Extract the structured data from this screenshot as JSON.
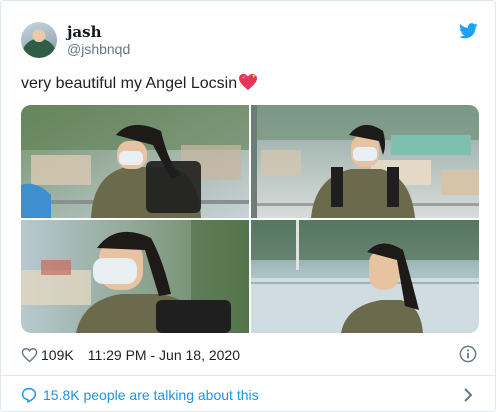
{
  "user": {
    "display_name": "jash",
    "handle": "@jshbnqd",
    "avatar_icon": "avatar-photo"
  },
  "brand_icon": "twitter-bird-icon",
  "tweet": {
    "text": "very beautiful my Angel Locsin",
    "emoji": "sparkling-heart"
  },
  "media": {
    "photos": [
      {
        "name": "photo-1"
      },
      {
        "name": "photo-2"
      },
      {
        "name": "photo-3"
      },
      {
        "name": "photo-4"
      }
    ]
  },
  "stats": {
    "likes": "109K",
    "timestamp": "11:29 PM - Jun 18, 2020"
  },
  "conversation": {
    "label": "15.8K people are talking about this"
  },
  "colors": {
    "link": "#1b95e0",
    "text": "#1c2022",
    "muted": "#657786",
    "border": "#e1e8ed"
  }
}
